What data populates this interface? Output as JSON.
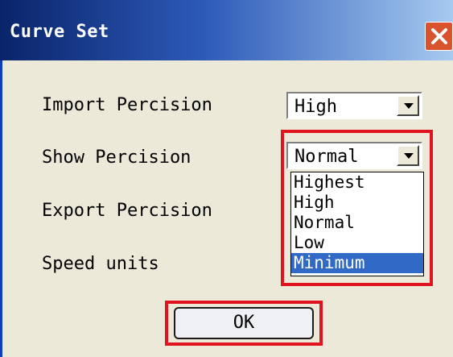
{
  "window": {
    "title": "Curve Set"
  },
  "fields": [
    {
      "label": "Import Percision",
      "value": "High"
    },
    {
      "label": "Show Percision",
      "value": "Normal"
    },
    {
      "label": "Export Percision"
    },
    {
      "label": "Speed units"
    }
  ],
  "dropdown": {
    "options": [
      "Highest",
      "High",
      "Normal",
      "Low",
      "Minimum"
    ],
    "highlighted": "Minimum"
  },
  "ok_button": {
    "label": "OK"
  },
  "colors": {
    "highlight_box": "#e0141e",
    "selection": "#3169c6",
    "title_bar": "#0a246a",
    "dialog_bg": "#ece9d8"
  },
  "icons": {
    "close": "close-icon",
    "dropdown": "chevron-down-icon"
  }
}
